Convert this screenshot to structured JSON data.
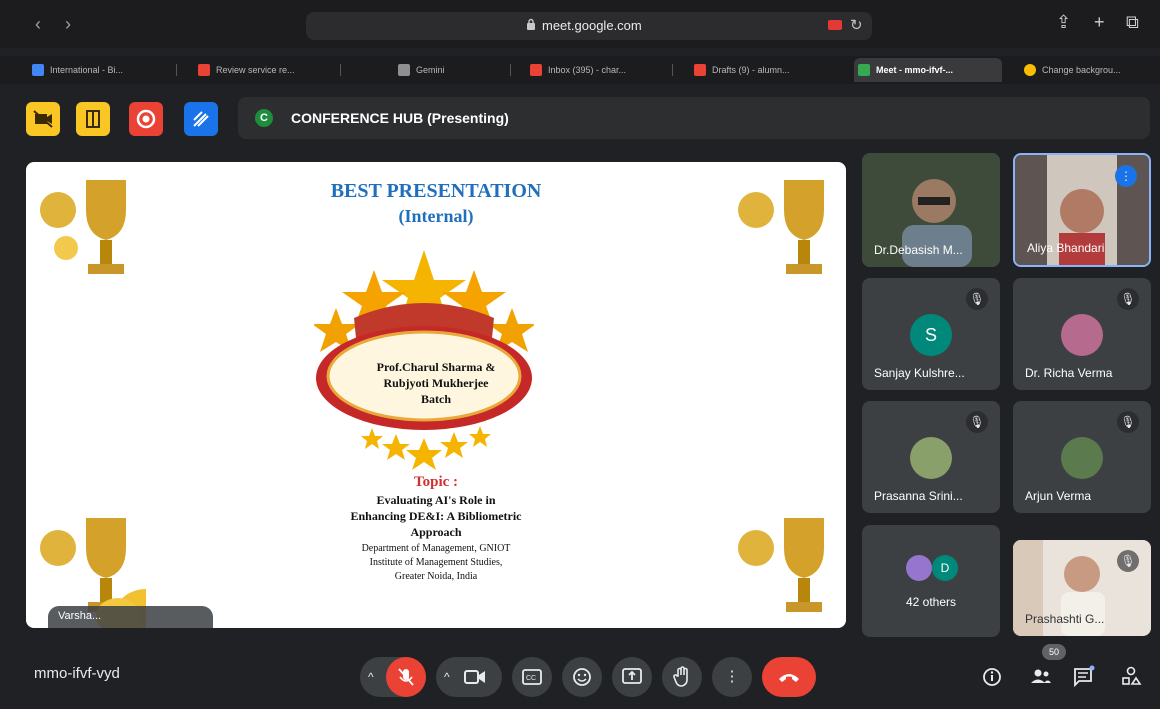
{
  "browser": {
    "url": "meet.google.com",
    "tabs": [
      {
        "label": "International - Bi...",
        "color": "#4285f4"
      },
      {
        "label": "Review service re...",
        "color": "#ea4335"
      },
      {
        "label": "Gemini",
        "color": "#8e8e93"
      },
      {
        "label": "Inbox (395) - char...",
        "color": "#ea4335"
      },
      {
        "label": "Drafts (9) - alumn...",
        "color": "#ea4335"
      },
      {
        "label": "Meet - mmo-ifvf-...",
        "color": "#34a853",
        "active": true
      },
      {
        "label": "Change backgrou...",
        "color": "#fbbc04"
      }
    ]
  },
  "extensions": [
    {
      "icon": "camera-off-icon",
      "color": "#f9c623"
    },
    {
      "icon": "door-icon",
      "color": "#f9c623"
    },
    {
      "icon": "record-icon",
      "color": "#ea4335"
    },
    {
      "icon": "pen-icon",
      "color": "#1a73e8"
    }
  ],
  "banner": {
    "initial": "C",
    "text": "CONFERENCE HUB (Presenting)"
  },
  "slide": {
    "title": "BEST PRESENTATION",
    "subtitle": "(Internal)",
    "awardees": [
      "Prof.Charul Sharma &",
      "Rubjyoti Mukherjee",
      "Batch"
    ],
    "topic_label": "Topic :",
    "topic_lines": [
      "Evaluating AI's Role in",
      "Enhancing DE&I: A Bibliometric",
      "Approach"
    ],
    "dept_lines": [
      "Department of Management, GNIOT",
      "Institute of Management Studies,",
      "Greater Noida, India"
    ],
    "speaker_chip": "Varsha..."
  },
  "participants": [
    {
      "name": "Dr.Debasish M...",
      "video": true,
      "bg": "#4a5a48"
    },
    {
      "name": "Aliya Bhandari",
      "video": true,
      "bg": "#7b6a63",
      "selected": true,
      "speaking": true
    },
    {
      "name": "Sanjay Kulshre...",
      "initial": "S",
      "avatar_color": "#00897b",
      "muted": true
    },
    {
      "name": "Dr. Richa Verma",
      "avatar_color": "#b56a8e",
      "muted": true
    },
    {
      "name": "Prasanna Srini...",
      "avatar_color": "#8aa06a",
      "muted": true
    },
    {
      "name": "Arjun Verma",
      "avatar_color": "#5b7a4e",
      "muted": true
    },
    {
      "name": "42 others",
      "others_initial": "D"
    },
    {
      "name": "Prashashti G...",
      "video": true,
      "bg": "#e9e3dc"
    }
  ],
  "bottom": {
    "meeting_code": "mmo-ifvf-vyd",
    "participant_count": "50"
  },
  "colors": {
    "accent_red": "#ea4335",
    "surface": "#3c4043",
    "background": "#202124"
  }
}
